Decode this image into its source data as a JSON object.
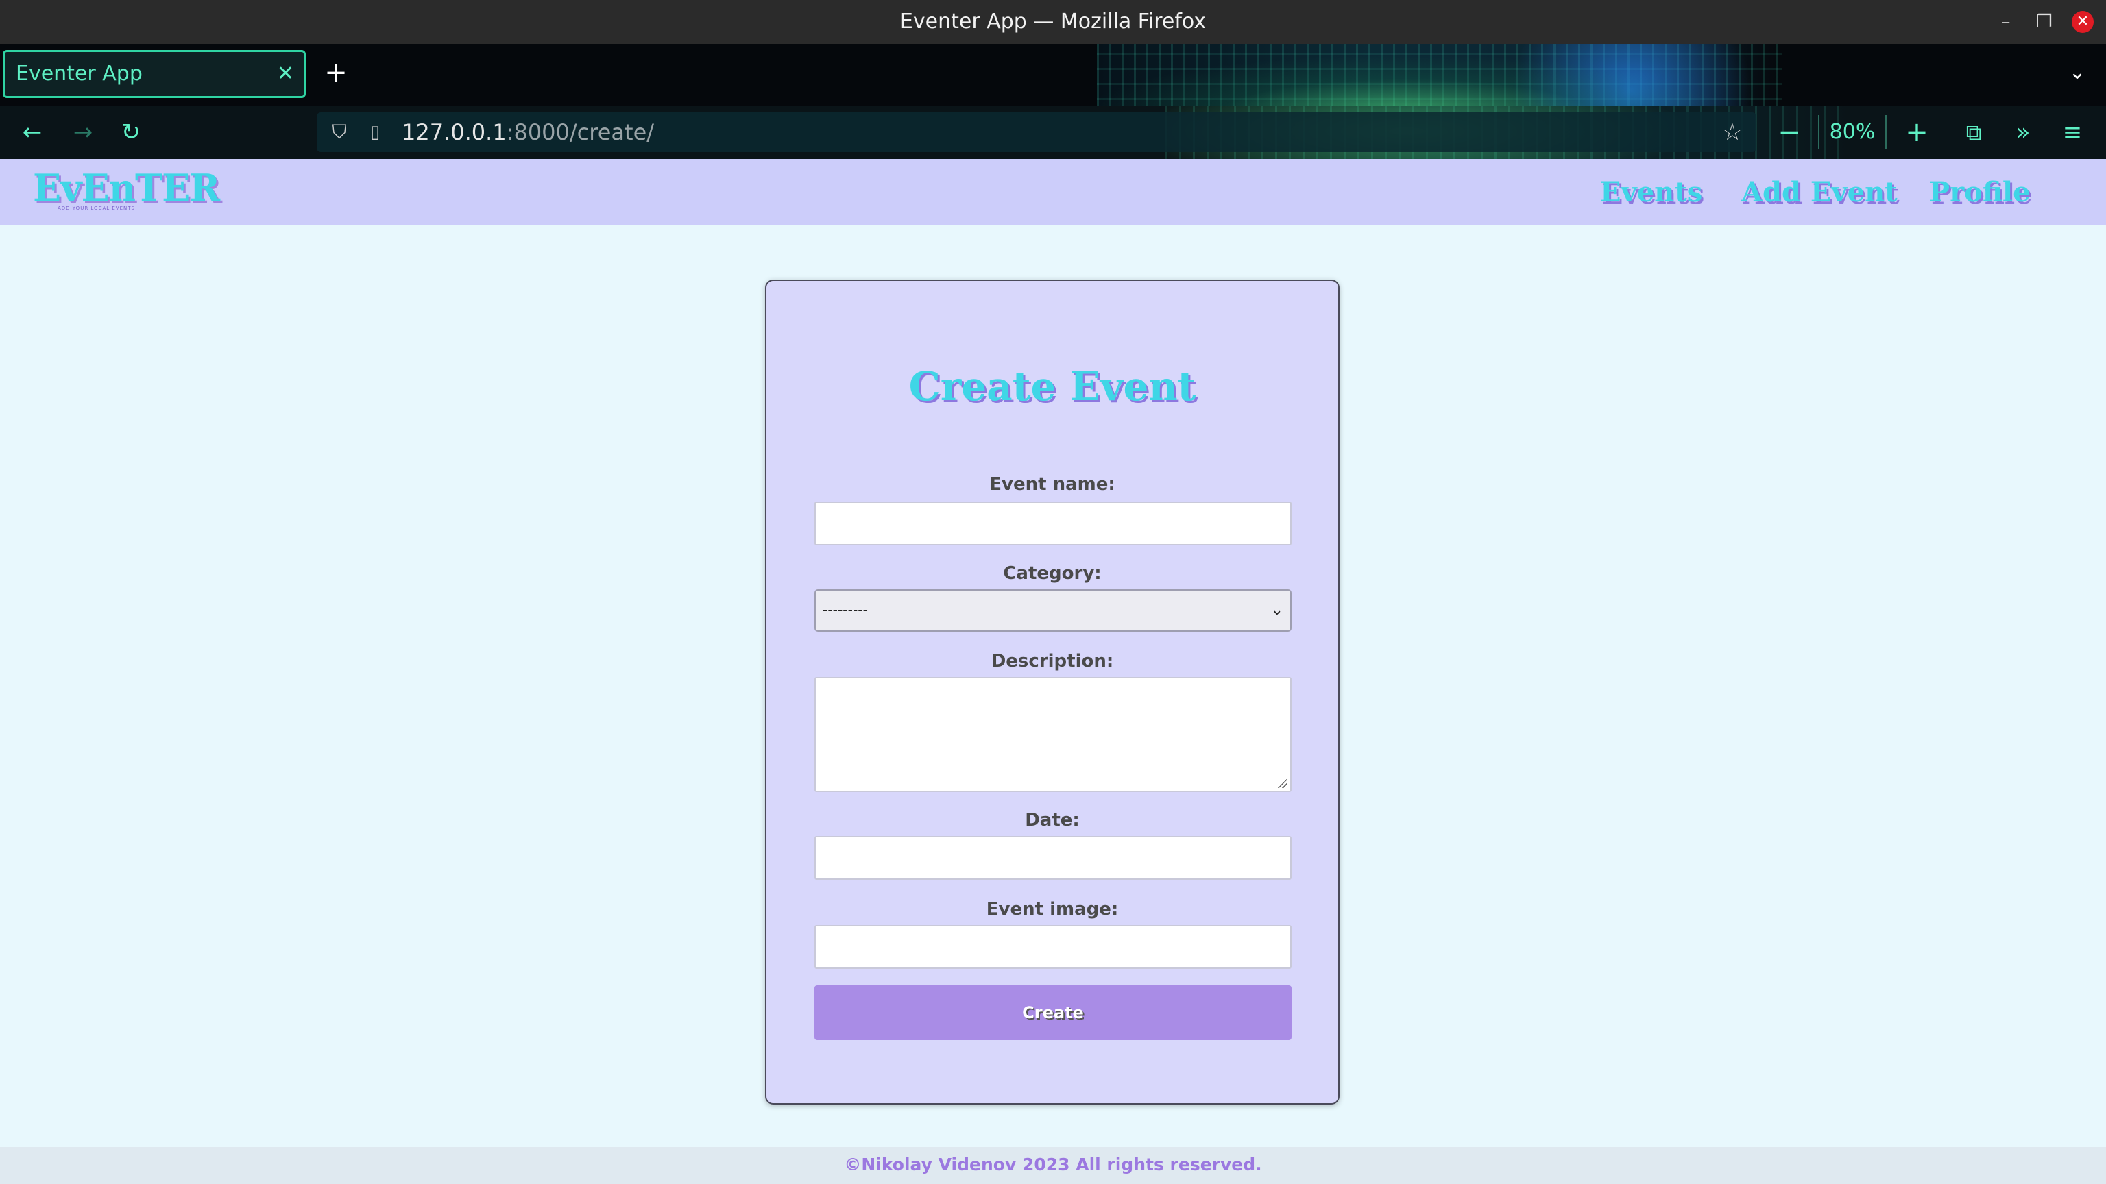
{
  "window": {
    "title": "Eventer App — Mozilla Firefox"
  },
  "browser": {
    "tab_title": "Eventer App",
    "url_host": "127.0.0.1",
    "url_path": ":8000/create/",
    "zoom": "80%"
  },
  "site": {
    "logo_text": "EvEnTER",
    "logo_tagline": "ADD YOUR LOCAL EVENTS",
    "nav": {
      "events": "Events",
      "add_event": "Add Event",
      "profile": "Profile"
    },
    "footer": "©Nikolay Videnov 2023 All rights reserved."
  },
  "form": {
    "title": "Create Event",
    "event_name_label": "Event name:",
    "event_name_value": "",
    "category_label": "Category:",
    "category_selected": "---------",
    "description_label": "Description:",
    "description_value": "",
    "date_label": "Date:",
    "date_value": "",
    "image_label": "Event image:",
    "image_value": "",
    "submit_label": "Create"
  },
  "icons": {
    "back": "back-arrow-icon",
    "forward": "forward-arrow-icon",
    "reload": "reload-icon",
    "shield": "shield-icon",
    "page": "page-icon",
    "star": "bookmark-star-icon",
    "extensions": "extensions-icon",
    "overflow": "chevron-double-right-icon",
    "menu": "hamburger-menu-icon"
  }
}
